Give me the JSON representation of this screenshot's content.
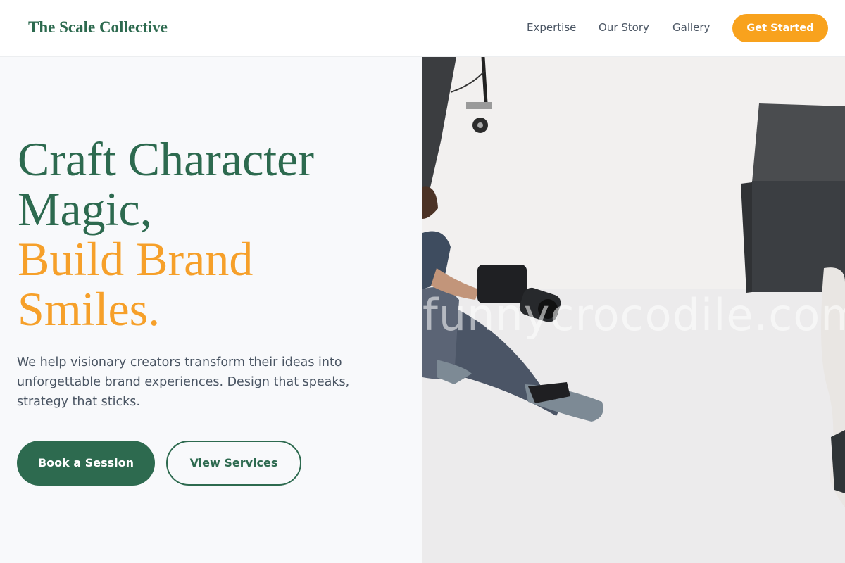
{
  "nav": {
    "brand": "The Scale Collective",
    "links": [
      "Expertise",
      "Our Story",
      "Gallery"
    ],
    "cta": "Get Started"
  },
  "hero": {
    "headline_lines": [
      "Craft Character",
      "Magic,",
      "Build Brand",
      "Smiles."
    ],
    "lead": "We help visionary creators transform their ideas into unforgettable brand experiences. Design that speaks, strategy that sticks.",
    "primary_button": "Book a Session",
    "secondary_button": "View Services",
    "image_watermark": "funnycrocodile.com"
  },
  "colors": {
    "brand_green": "#2d6a4f",
    "accent_orange": "#f8a21d",
    "panel_background": "#f8f9fb"
  }
}
